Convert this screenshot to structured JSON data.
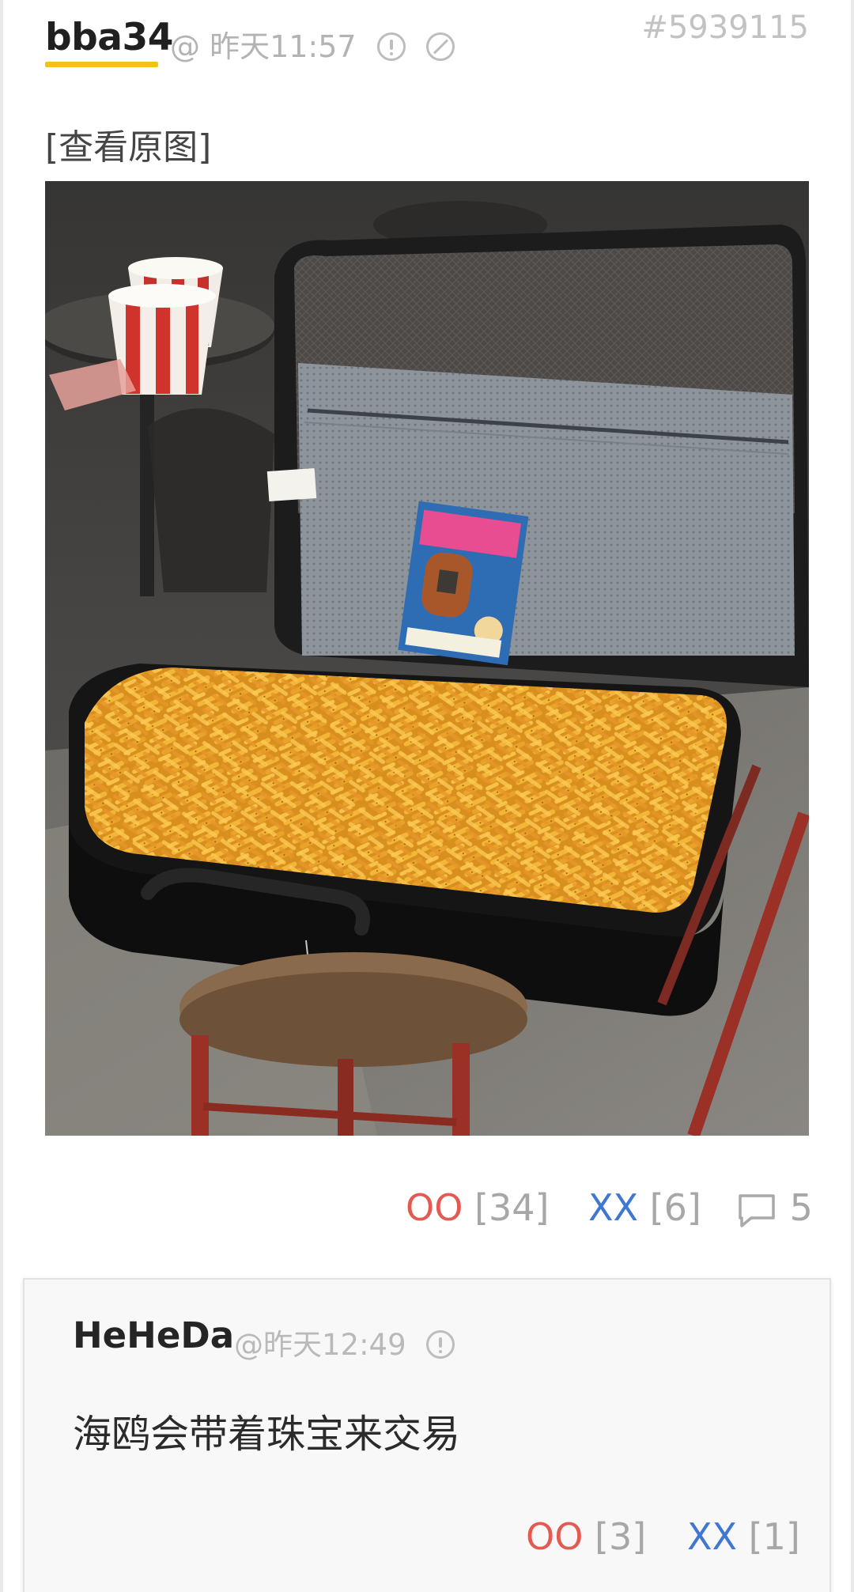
{
  "post": {
    "author": "bba34",
    "meta_time": "@ 昨天11:57",
    "id": "#5939115",
    "view_original": "[查看原图]",
    "photo_alt": "suitcase filled with french fries",
    "votes": {
      "oo_label": "OO",
      "oo_count": "[34]",
      "xx_label": "XX",
      "xx_count": "[6]",
      "comments": "5"
    }
  },
  "comment": {
    "author": "HeHeDa",
    "meta_time": "@昨天12:49",
    "text": "海鸥会带着珠宝来交易",
    "votes": {
      "oo_label": "OO",
      "oo_count": "[3]",
      "xx_label": "XX",
      "xx_count": "[1]"
    }
  },
  "colors": {
    "accent_underline": "#f2c21b",
    "oo": "#e35a52",
    "xx": "#3f77d1",
    "muted": "#b3b3b3"
  },
  "icons": {
    "report": "warn-circle-icon",
    "block": "ban-circle-icon",
    "comments": "speech-bubble-icon"
  }
}
